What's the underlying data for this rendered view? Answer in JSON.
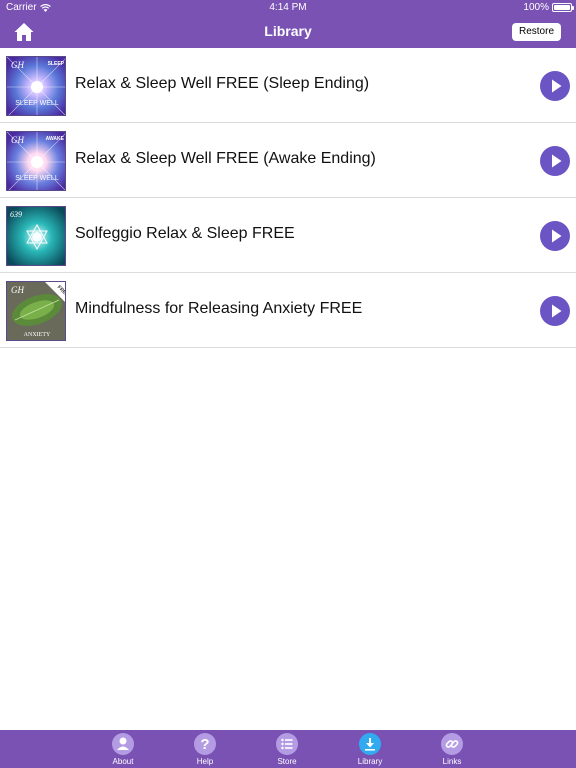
{
  "status_bar": {
    "carrier": "Carrier",
    "time": "4:14 PM",
    "battery": "100%"
  },
  "nav": {
    "title": "Library",
    "restore_label": "Restore",
    "home_icon": "home-icon"
  },
  "colors": {
    "brand": "#7a52b4",
    "play_button": "#6b54c4",
    "tab_icon": "#b49ce4",
    "tab_active": "#32aaf0"
  },
  "items": [
    {
      "title": "Relax & Sleep Well FREE (Sleep Ending)",
      "thumb_badge": "SLEEP",
      "thumb_mark": "GH",
      "thumb_caption": "SLEEP WELL"
    },
    {
      "title": "Relax & Sleep Well FREE (Awake Ending)",
      "thumb_badge": "AWAKE",
      "thumb_mark": "GH",
      "thumb_caption": "SLEEP WELL"
    },
    {
      "title": "Solfeggio Relax & Sleep FREE",
      "thumb_badge": "",
      "thumb_mark": "639",
      "thumb_caption": ""
    },
    {
      "title": "Mindfulness for Releasing Anxiety FREE",
      "thumb_badge": "FREE",
      "thumb_mark": "GH",
      "thumb_caption": "ANXIETY"
    }
  ],
  "tabs": [
    {
      "label": "About",
      "icon": "user-icon"
    },
    {
      "label": "Help",
      "icon": "question-icon"
    },
    {
      "label": "Store",
      "icon": "list-icon"
    },
    {
      "label": "Library",
      "icon": "download-icon",
      "active": true
    },
    {
      "label": "Links",
      "icon": "link-icon"
    }
  ]
}
